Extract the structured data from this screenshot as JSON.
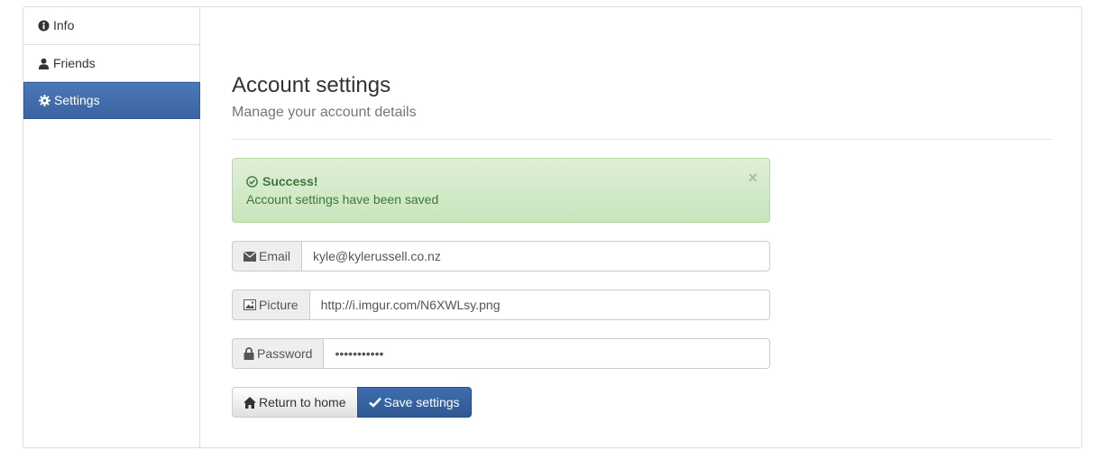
{
  "sidebar": {
    "items": [
      {
        "label": "Info",
        "icon": "info-circle-icon"
      },
      {
        "label": "Friends",
        "icon": "user-icon"
      },
      {
        "label": "Settings",
        "icon": "cog-icon",
        "active": true
      }
    ]
  },
  "header": {
    "title": "Account settings",
    "subtitle": "Manage your account details"
  },
  "alert": {
    "title": "Success!",
    "message": "Account settings have been saved",
    "close": "×"
  },
  "form": {
    "email": {
      "label": "Email",
      "value": "kyle@kylerussell.co.nz"
    },
    "picture": {
      "label": "Picture",
      "value": "http://i.imgur.com/N6XWLsy.png"
    },
    "password": {
      "label": "Password",
      "value": "•••••••••••"
    }
  },
  "buttons": {
    "home_label": "Return to home",
    "save_label": "Save settings"
  },
  "colors": {
    "primary": "#3b63a0",
    "success_bg": "#dff0d8",
    "success_text": "#3c763d"
  }
}
